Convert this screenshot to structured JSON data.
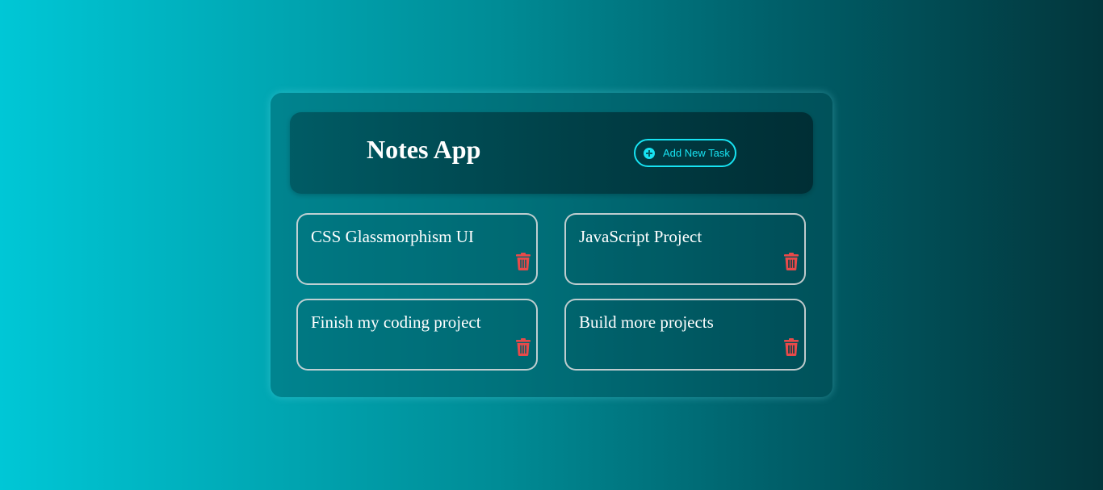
{
  "header": {
    "title": "Notes App",
    "add_button_label": "Add New Task",
    "add_icon": "plus-circle-icon"
  },
  "notes": [
    {
      "text": "CSS Glassmorphism UI",
      "delete_icon": "trash-icon"
    },
    {
      "text": "JavaScript Project",
      "delete_icon": "trash-icon"
    },
    {
      "text": "Finish my coding project",
      "delete_icon": "trash-icon"
    },
    {
      "text": "Build more projects",
      "delete_icon": "trash-icon"
    }
  ],
  "colors": {
    "accent": "#17e3f2",
    "delete": "#e84a4a",
    "text": "#ffffff"
  }
}
